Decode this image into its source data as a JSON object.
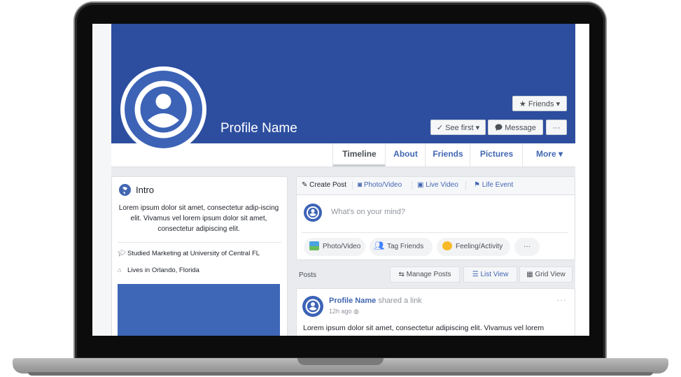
{
  "profile": {
    "name": "Profile Name"
  },
  "cover_buttons": {
    "friends": "Friends",
    "see_first": "See first",
    "message": "Message",
    "more": "···"
  },
  "tabs": [
    "Timeline",
    "About",
    "Friends",
    "Pictures",
    "More"
  ],
  "intro": {
    "title": "Intro",
    "bio": "Lorem ipsum dolor sit amet, consectetur adip-iscing elit.  Vivamus vel lorem ipsum dolor sit amet, consectetur adipiscing elit.",
    "studied": "Studied Marketing at University of Central FL",
    "lives": "Lives in Orlando, Florida"
  },
  "composer": {
    "tabs": [
      "Create Post",
      "Photo/Video",
      "Live Video",
      "Life Event"
    ],
    "placeholder": "What's on your mind?",
    "actions": [
      "Photo/Video",
      "Tag Friends",
      "Feeling/Activity",
      "···"
    ]
  },
  "posts": {
    "label": "Posts",
    "manage": "Manage Posts",
    "list_view": "List View",
    "grid_view": "Grid View"
  },
  "post": {
    "author": "Profile Name",
    "action": "shared a link",
    "time": "12h ago",
    "text": "Lorem ipsum dolor sit amet, consectetur adipiscing elit.  Vivamus vel lorem",
    "menu": "···"
  },
  "colors": {
    "brand": "#2d4e9f",
    "link": "#4267b2"
  }
}
